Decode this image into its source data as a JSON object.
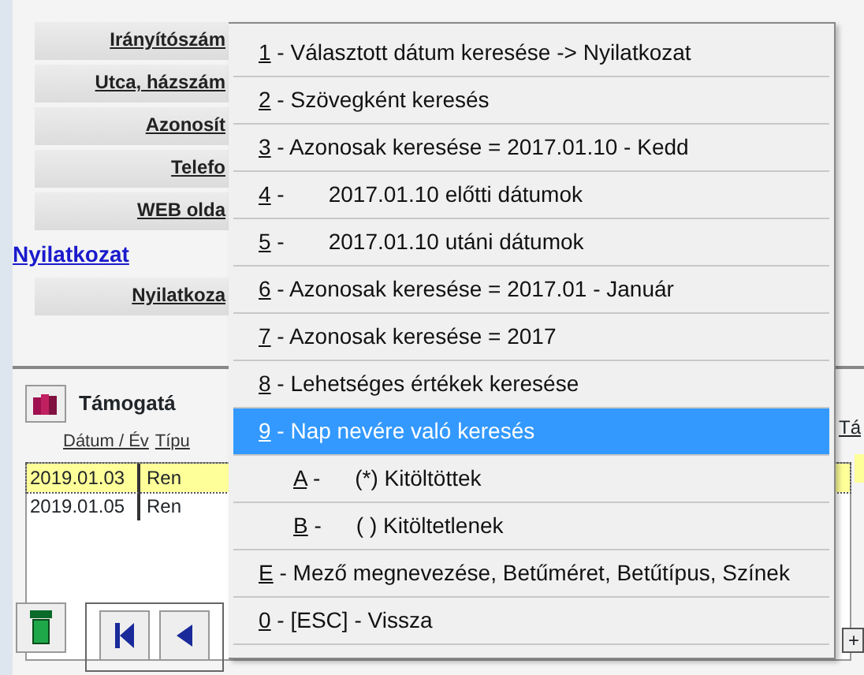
{
  "form_fields": [
    {
      "kind": "label",
      "text": "Irányítószám"
    },
    {
      "kind": "label",
      "text": "Utca, házszám"
    },
    {
      "kind": "label",
      "text": "Azonosít"
    },
    {
      "kind": "label",
      "text": "Telefo"
    },
    {
      "kind": "label",
      "text": "WEB olda"
    },
    {
      "kind": "link",
      "text": "Nyilatkozat"
    },
    {
      "kind": "label",
      "text": "Nyilatkoza"
    }
  ],
  "subpanel": {
    "title": "Támogatá",
    "columns": [
      "Dátum / Év",
      "Típu"
    ],
    "rows": [
      {
        "cells": [
          "2019.01.03",
          "Ren"
        ],
        "selected": true
      },
      {
        "cells": [
          "2019.01.05",
          "Ren"
        ],
        "selected": false
      }
    ]
  },
  "right_column_header": "Tá",
  "add_button": "+",
  "context_menu": [
    {
      "key": "1",
      "label": "- Választott dátum keresése -> Nyilatkozat",
      "selected": false
    },
    {
      "key": "2",
      "label": "- Szövegként keresés",
      "selected": false
    },
    {
      "key": "3",
      "label": "- Azonosak keresése = 2017.01.10 - Kedd",
      "selected": false
    },
    {
      "key": "4",
      "label": "-",
      "detail": "2017.01.10  előtti dátumok",
      "selected": false
    },
    {
      "key": "5",
      "label": "-",
      "detail": "2017.01.10  utáni dátumok",
      "selected": false
    },
    {
      "key": "6",
      "label": "- Azonosak keresése = 2017.01 - Január",
      "selected": false
    },
    {
      "key": "7",
      "label": "- Azonosak keresése = 2017",
      "selected": false
    },
    {
      "key": "8",
      "label": "- Lehetséges értékek keresése",
      "selected": false
    },
    {
      "key": "9",
      "label": "- Nap nevére való keresés",
      "selected": true
    },
    {
      "key": "A",
      "label": "-",
      "detail": "(*) Kitöltöttek",
      "sub": true,
      "selected": false
    },
    {
      "key": "B",
      "label": "-",
      "detail": "( ) Kitöltetlenek",
      "sub": true,
      "selected": false
    },
    {
      "key": "E",
      "label": "- Mező megnevezése, Betűméret, Betűtípus, Színek",
      "selected": false
    },
    {
      "key": "0",
      "label": "- [ESC] - Vissza",
      "selected": false
    }
  ]
}
